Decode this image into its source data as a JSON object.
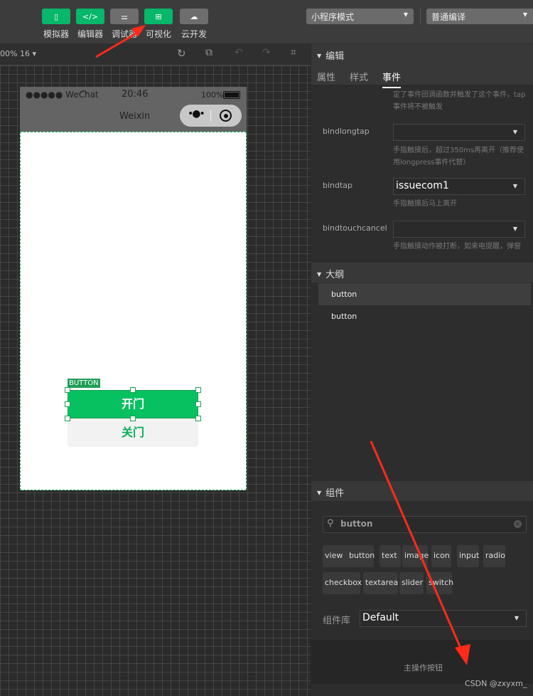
{
  "toolbar": {
    "buttons": [
      {
        "label": "模拟器",
        "icon": "phone-icon",
        "icon_glyph": "▯"
      },
      {
        "label": "编辑器",
        "icon": "code-icon",
        "icon_glyph": "</>"
      },
      {
        "label": "调试器",
        "icon": "sliders-icon",
        "icon_glyph": "⚌"
      },
      {
        "label": "可视化",
        "icon": "layout-icon",
        "icon_glyph": "⊞",
        "active": true
      },
      {
        "label": "云开发",
        "icon": "cloud-icon",
        "icon_glyph": "☁"
      }
    ],
    "mode_select": "小程序模式",
    "compile_select": "普通编译"
  },
  "sim_toolbar": {
    "zoom": "00% 16"
  },
  "phone": {
    "signal": "●●●●● WeChat",
    "time": "20:46",
    "battery": "100%",
    "title": "Weixin",
    "selection_tag": "BUTTON",
    "btn_open": "开门",
    "btn_close": "关门"
  },
  "editor": {
    "header": "编辑",
    "tabs": [
      "属性",
      "样式",
      "事件"
    ],
    "active_tab": "事件",
    "clipped_hint": [
      "定了事件回调函数并触发了这个事件，tap",
      "事件将不被触发"
    ],
    "events": [
      {
        "name": "bindlongtap",
        "value": "",
        "hint": "手指触摸后，超过350ms再离开（推荐使用longpress事件代替）"
      },
      {
        "name": "bindtap",
        "value": "issuecom1",
        "hint": "手指触摸后马上离开"
      },
      {
        "name": "bindtouchcancel",
        "value": "",
        "hint": "手指触摸动作被打断，如来电提醒，弹窗"
      }
    ]
  },
  "outline": {
    "header": "大纲",
    "items": [
      "button",
      "button"
    ]
  },
  "components": {
    "header": "组件",
    "search_value": "button",
    "chips": [
      "view",
      "button",
      "text",
      "image",
      "icon",
      "input",
      "radio",
      "checkbox",
      "textarea",
      "slider",
      "switch"
    ],
    "library_label": "组件库",
    "library_value": "Default",
    "description": "主操作按钮"
  },
  "watermark": "CSDN @zxyxm_",
  "colors": {
    "accent": "#07c160",
    "annotation_arrow": "#ff2a1a"
  }
}
